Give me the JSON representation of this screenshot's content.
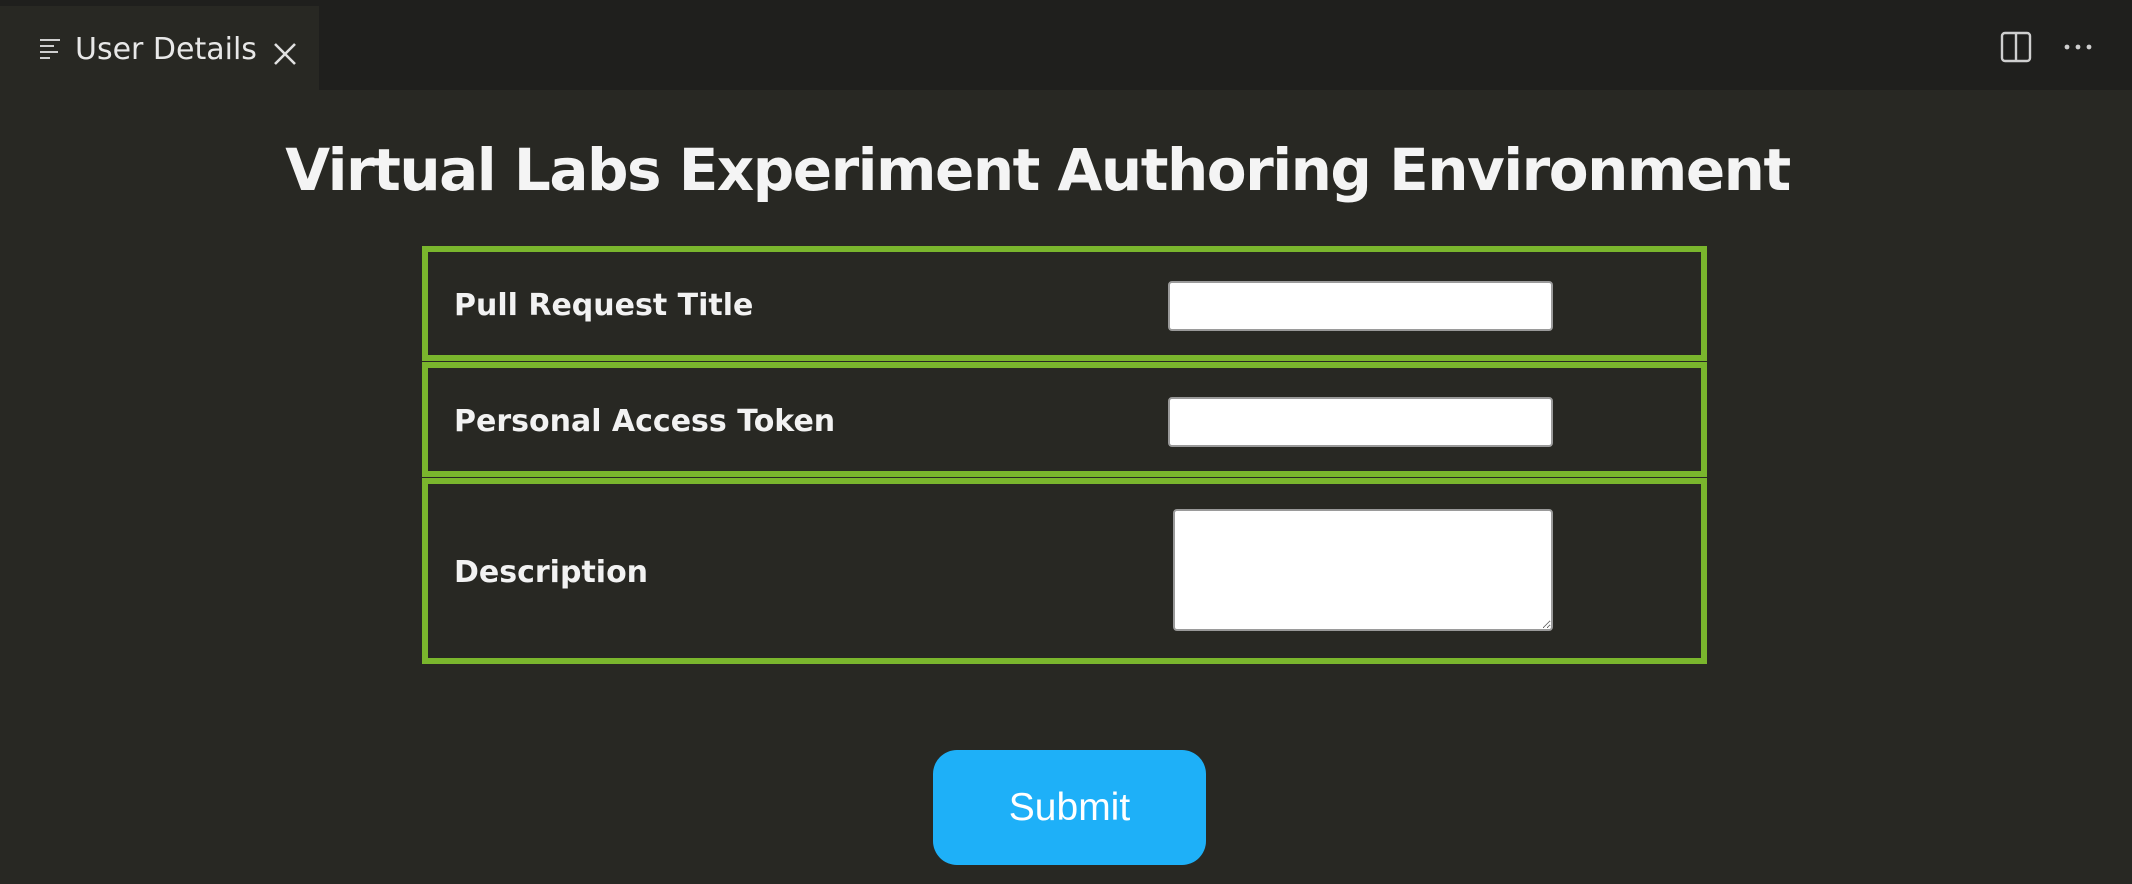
{
  "tab": {
    "icon": "list-icon",
    "label": "User Details",
    "close_icon": "close-icon"
  },
  "tabbar_actions": {
    "split_icon": "split-editor-icon",
    "more_icon": "more-actions-icon"
  },
  "page": {
    "title": "Virtual Labs Experiment Authoring Environment"
  },
  "form": {
    "fields": [
      {
        "label": "Pull Request Title",
        "value": "",
        "type": "text"
      },
      {
        "label": "Personal Access Token",
        "value": "",
        "type": "text"
      },
      {
        "label": "Description",
        "value": "",
        "type": "textarea"
      }
    ],
    "submit_label": "Submit"
  },
  "colors": {
    "background": "#282823",
    "tabbar": "#1f1f1d",
    "row_border": "#7ab62d",
    "submit_button": "#1eb0f8",
    "text": "#f2f2f2"
  }
}
